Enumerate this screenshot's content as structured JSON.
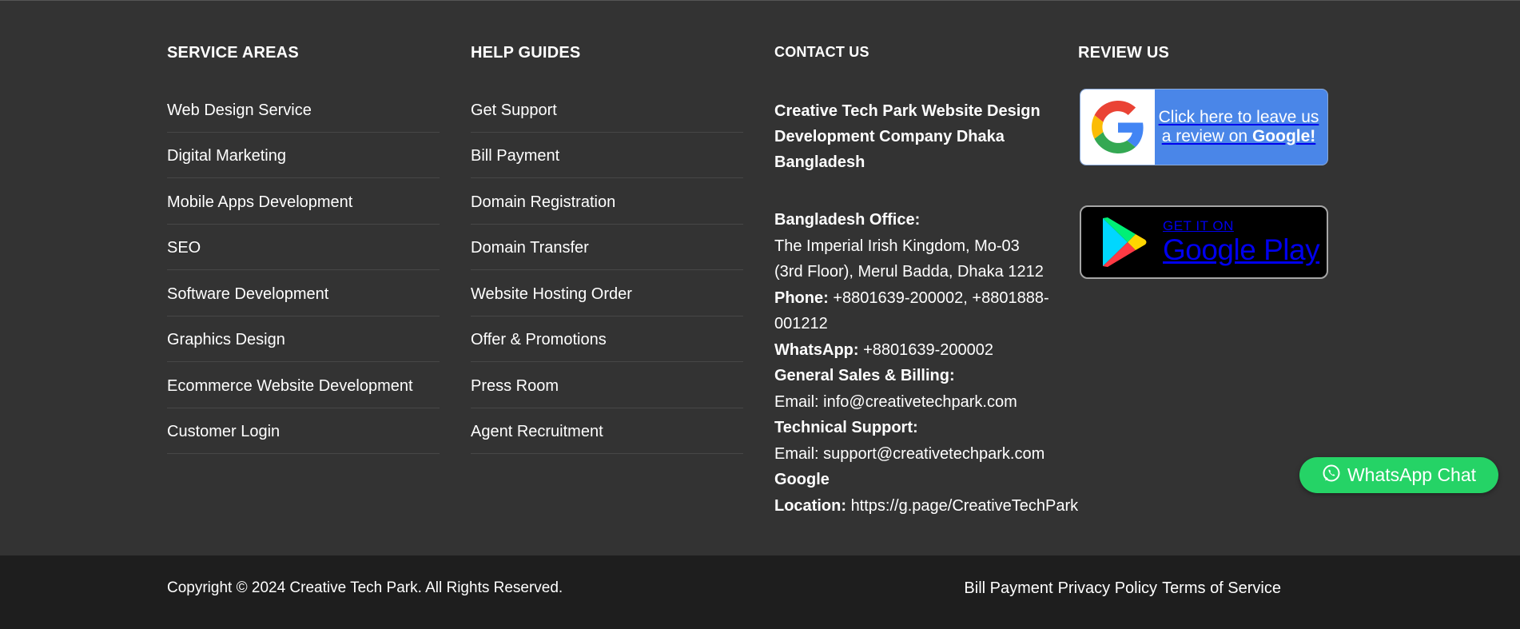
{
  "service_areas": {
    "heading": "SERVICE AREAS",
    "items": [
      {
        "label": "Web Design Service"
      },
      {
        "label": "Digital Marketing"
      },
      {
        "label": "Mobile Apps Development"
      },
      {
        "label": "SEO"
      },
      {
        "label": "Software Development"
      },
      {
        "label": "Graphics Design"
      },
      {
        "label": "Ecommerce Website Development"
      },
      {
        "label": "Customer Login"
      }
    ]
  },
  "help_guides": {
    "heading": "HELP GUIDES",
    "items": [
      {
        "label": "Get Support"
      },
      {
        "label": "Bill Payment"
      },
      {
        "label": "Domain Registration"
      },
      {
        "label": "Domain Transfer"
      },
      {
        "label": "Website Hosting Order"
      },
      {
        "label": "Offer & Promotions"
      },
      {
        "label": "Press Room"
      },
      {
        "label": "Agent Recruitment"
      }
    ]
  },
  "contact": {
    "heading": "CONTACT US",
    "company_line1": "Creative Tech Park Website Design",
    "company_line2": "Development Company Dhaka",
    "company_line3": "Bangladesh",
    "office_label": "Bangladesh Office:",
    "address_line1": "The Imperial Irish Kingdom, Mo-03",
    "address_line2": "(3rd Floor), Merul Badda, Dhaka 1212",
    "phone_label": "Phone:",
    "phone_value_line1": "+8801639-200002, +8801888-",
    "phone_value_line2": "001212",
    "whatsapp_label": "WhatsApp:",
    "whatsapp_value": "+8801639-200002",
    "sales_label": "General Sales & Billing:",
    "sales_email_prefix": "Email:",
    "sales_email": "info@creativetechpark.com",
    "support_label": "Technical Support:",
    "support_email_prefix": "Email:",
    "support_email": "support@creativetechpark.com",
    "location_label_line1": "Google",
    "location_label_line2": "Location:",
    "location_value": "https://g.page/CreativeTechPark"
  },
  "review": {
    "heading": "REVIEW US",
    "google_review_line1": "Click here to leave us",
    "google_review_line2_prefix": "a review on",
    "google_review_line2_brand": "Google!",
    "play_small": "GET IT ON",
    "play_big": "Google Play"
  },
  "whatsapp_chat": {
    "label": "WhatsApp Chat"
  },
  "bottom_bar": {
    "copyright": "Copyright © 2024 Creative Tech Park. All Rights Reserved.",
    "links": [
      {
        "label": "Bill Payment"
      },
      {
        "label": "Privacy Policy"
      },
      {
        "label": "Terms of Service"
      }
    ]
  },
  "colors": {
    "footer_bg": "#333333",
    "bottom_bar_bg": "#1e1e1e",
    "review_blue": "#4a86e8",
    "whatsapp_green": "#25d366"
  },
  "icons": [
    "google-g-icon",
    "google-play-icon",
    "whatsapp-icon"
  ]
}
